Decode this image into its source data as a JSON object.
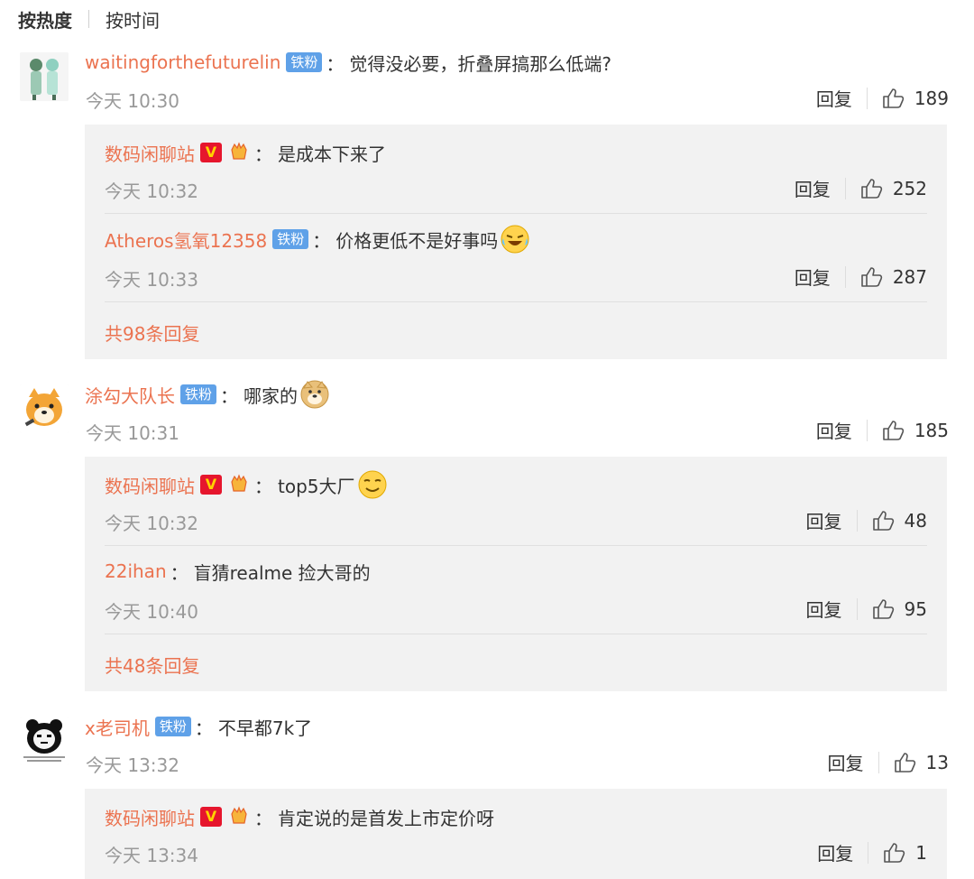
{
  "tabs": {
    "hot": "按热度",
    "time": "按时间"
  },
  "reply_label": "回复",
  "comments": [
    {
      "user": "waitingforthefuturelin",
      "badge": "铁粉",
      "text": "觉得没必要，折叠屏搞那么低端?",
      "time": "今天 10:30",
      "likes": "189",
      "replies": [
        {
          "user": "数码闲聊站",
          "text": "是成本下来了",
          "time": "今天 10:32",
          "likes": "252"
        },
        {
          "user": "Atheros氢氧12358",
          "badge": "铁粉",
          "text": "价格更低不是好事吗",
          "time": "今天 10:33",
          "likes": "287"
        }
      ],
      "more": "共98条回复"
    },
    {
      "user": "涂勾大队长",
      "badge": "铁粉",
      "text": "哪家的",
      "time": "今天 10:31",
      "likes": "185",
      "replies": [
        {
          "user": "数码闲聊站",
          "text": "top5大厂",
          "time": "今天 10:32",
          "likes": "48"
        },
        {
          "user": "22ihan",
          "text": "盲猜realme 捡大哥的",
          "time": "今天 10:40",
          "likes": "95"
        }
      ],
      "more": "共48条回复"
    },
    {
      "user": "x老司机",
      "badge": "铁粉",
      "text": "不早都7k了",
      "time": "今天 13:32",
      "likes": "13",
      "replies": [
        {
          "user": "数码闲聊站",
          "text": "肯定说的是首发上市定价呀",
          "time": "今天 13:34",
          "likes": "1"
        }
      ]
    }
  ],
  "colors": {
    "username": "#eb7350",
    "badge": "#5fa1e8",
    "reply_bg": "#f2f2f2",
    "time": "#999999"
  }
}
